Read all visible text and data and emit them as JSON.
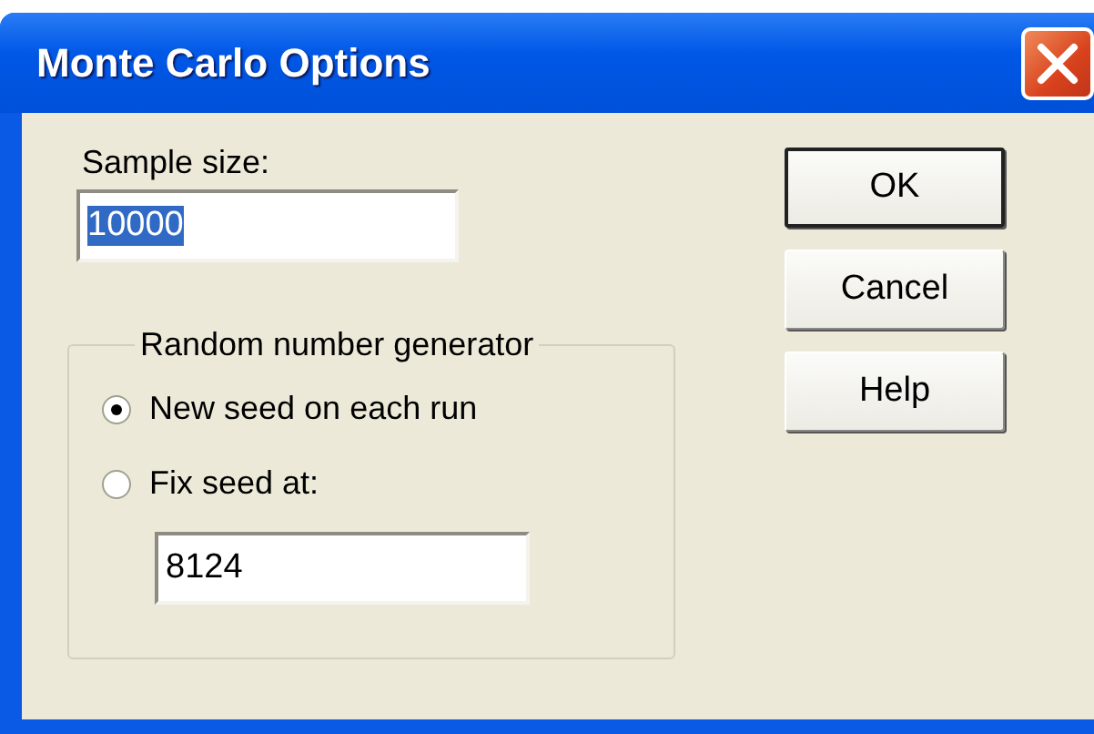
{
  "window": {
    "title": "Monte Carlo Options"
  },
  "sample_size": {
    "label": "Sample size:",
    "value": "10000",
    "value_selected": true
  },
  "random_number_generator": {
    "legend": "Random number generator",
    "options": [
      {
        "label": "New seed on each run",
        "selected": true
      },
      {
        "label": "Fix seed at:",
        "selected": false
      }
    ],
    "seed_field": {
      "value": "8124"
    }
  },
  "buttons": [
    {
      "label": "OK",
      "default": true
    },
    {
      "label": "Cancel",
      "default": false
    },
    {
      "label": "Help",
      "default": false
    }
  ]
}
